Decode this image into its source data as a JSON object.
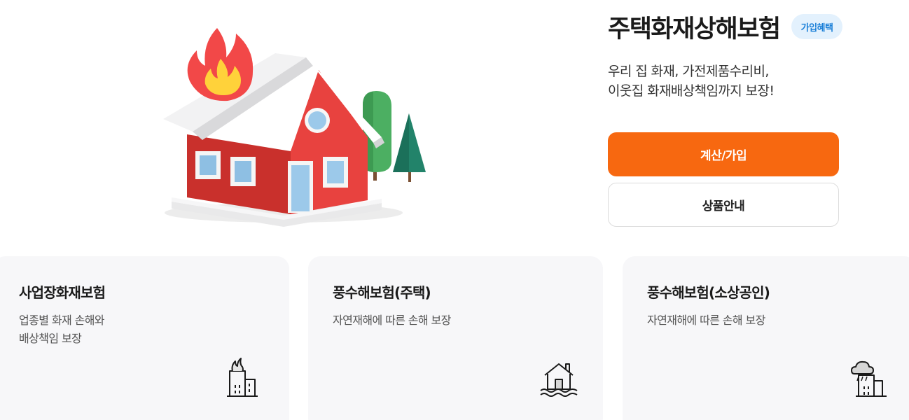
{
  "hero": {
    "illustration_icon": "burning-house-illustration"
  },
  "product": {
    "title": "주택화재상해보험",
    "badge": "가입혜택",
    "desc_line1": "우리 집 화재, 가전제품수리비,",
    "desc_line2": "이웃집 화재배상책임까지 보장!",
    "primary_button": "계산/가입",
    "secondary_button": "상품안내"
  },
  "cards": [
    {
      "title": "사업장화재보험",
      "desc": "업종별 화재 손해와\n배상책임 보장",
      "icon": "building-fire-icon"
    },
    {
      "title": "풍수해보험(주택)",
      "desc": "자연재해에 따른 손해 보장",
      "icon": "house-flood-icon"
    },
    {
      "title": "풍수해보험(소상공인)",
      "desc": "자연재해에 따른 손해 보장",
      "icon": "building-storm-icon"
    }
  ],
  "colors": {
    "accent_orange": "#f76810",
    "badge_bg": "#e3f1fd",
    "badge_text": "#1a7fd8",
    "card_bg": "#f7f7f9",
    "house_red": "#e8423f"
  }
}
